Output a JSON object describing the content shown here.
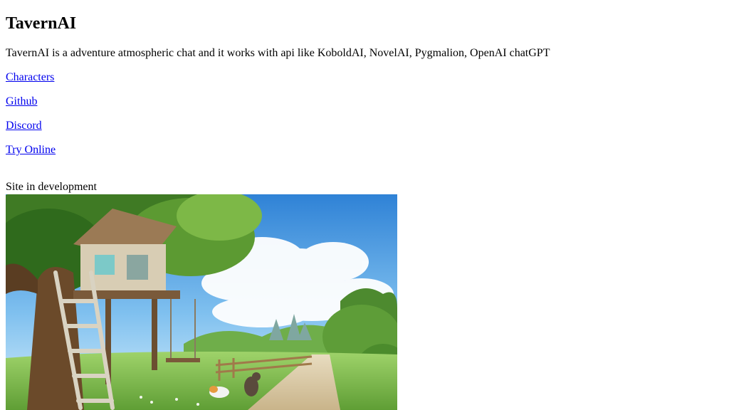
{
  "header": {
    "title": "TavernAI"
  },
  "intro": {
    "description": "TavernAI is a adventure atmospheric chat and it works with api like KoboldAI, NovelAI, Pygmalion, OpenAI chatGPT"
  },
  "links": [
    {
      "label": "Characters"
    },
    {
      "label": "Github"
    },
    {
      "label": "Discord"
    },
    {
      "label": "Try Online"
    }
  ],
  "status": {
    "text": "Site in development"
  },
  "colors": {
    "link": "#0000ee",
    "sky_top": "#3f8fd9",
    "sky_bottom": "#bfe3f7",
    "grass": "#7fbf4a",
    "tree": "#5d7a3a"
  }
}
